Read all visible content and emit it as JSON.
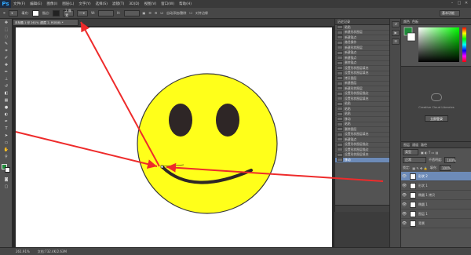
{
  "app": {
    "logo": "Ps"
  },
  "menu": {
    "items": [
      "文件(F)",
      "编辑(E)",
      "图像(I)",
      "图层(L)",
      "文字(Y)",
      "选择(S)",
      "滤镜(T)",
      "3D(D)",
      "视图(V)",
      "窗口(W)",
      "帮助(H)"
    ]
  },
  "options": {
    "mode_label": "模式:",
    "mode_value": "正常",
    "opacity_label": "不透明度:",
    "opacity_value": "100%",
    "flow_value": "100%",
    "size_value": "2 像素",
    "auto_add_label": "自动添加/删除",
    "align_label": "对齐边缘",
    "workspace": "基本功能"
  },
  "document": {
    "tab_title": "未标题-1 @ 261% (图层 2, RGB/8) *"
  },
  "status": {
    "zoom": "261.91%",
    "doc": "文档:732.4K/2.63M"
  },
  "history": {
    "title": "历史记录",
    "items": [
      "粘贴",
      "新建形状图层",
      "新建锚点",
      "路径操作",
      "新建形状图层",
      "新建锚点",
      "新建锚点",
      "删除锚点",
      "设置形状图层填充",
      "设置形状图层填充",
      "拷贝图层",
      "新建图层",
      "新建形状图层",
      "设置形状图层描边",
      "设置形状图层填充",
      "粘贴",
      "粘贴",
      "粘贴",
      "移动",
      "粘贴",
      "删除图层",
      "设置形状图层填充",
      "新建锚点",
      "设置形状图层描边",
      "设置形状图层描边",
      "设置形状图层填充",
      "移动"
    ],
    "selected": 26
  },
  "color_panel": {
    "tabs": [
      "颜色",
      "色板"
    ]
  },
  "cc_panel": {
    "message": "Creative Cloud Libraries",
    "button": "立即登录"
  },
  "layers": {
    "tabs": [
      "图层",
      "通道",
      "路径"
    ],
    "filter": "类型",
    "blend": "正常",
    "opacity_label": "不透明度:",
    "opacity": "100%",
    "lock_label": "锁定:",
    "fill_label": "填充:",
    "fill": "100%",
    "rows": [
      "形状 2",
      "形状 1",
      "椭圆 1 拷贝",
      "椭圆 1",
      "图层 1",
      "背景"
    ],
    "selected": 0
  },
  "colors": {
    "face": "#ffff1a",
    "eye": "#2e2626",
    "stroke": "#3a3a3a",
    "arrow": "#ee2b2b",
    "foreground": "#1f8c3a"
  }
}
